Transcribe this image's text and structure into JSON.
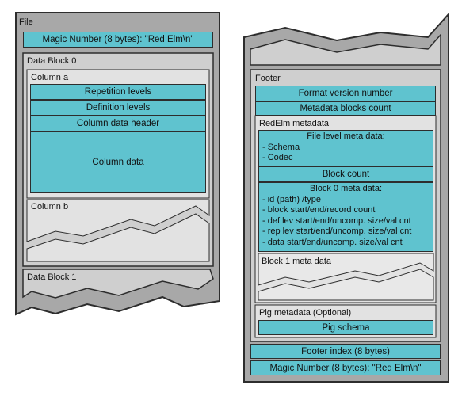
{
  "file": {
    "title": "File",
    "magic_top": "Magic Number (8 bytes): \"Red Elm\\n\"",
    "block0": {
      "title": "Data Block 0",
      "column_a": {
        "title": "Column a",
        "rows": [
          "Repetition levels",
          "Definition levels",
          "Column data header",
          "Column data"
        ]
      },
      "column_b": {
        "title": "Column b"
      }
    },
    "block1": {
      "title": "Data Block 1"
    }
  },
  "footer": {
    "title": "Footer",
    "format_version": "Format version number",
    "metadata_blocks_count": "Metadata blocks count",
    "redelm_metadata": {
      "title": "RedElm metadata",
      "file_level": {
        "head": "File level meta data:",
        "lines": [
          "- Schema",
          "- Codec"
        ]
      },
      "block_count": "Block count",
      "block0_meta": {
        "head": "Block 0 meta data:",
        "lines": [
          "- id (path) /type",
          "- block start/end/record count",
          "- def lev start/end/uncomp. size/val cnt",
          "- rep lev start/end/uncomp. size/val cnt",
          "- data start/end/uncomp. size/val cnt"
        ]
      },
      "block1_meta": {
        "title": "Block 1 meta data"
      }
    },
    "pig_metadata": {
      "title": "Pig metadata (Optional)",
      "pig_schema": "Pig schema"
    },
    "footer_index": "Footer index (8 bytes)",
    "magic_bottom": "Magic Number (8 bytes): \"Red Elm\\n\""
  },
  "colors": {
    "teal": "#5fc3cf",
    "outer_gray": "#a8a8a8",
    "inner_gray": "#d6d6d6",
    "light_gray": "#e4e4e4",
    "border": "#2d2d2d"
  }
}
